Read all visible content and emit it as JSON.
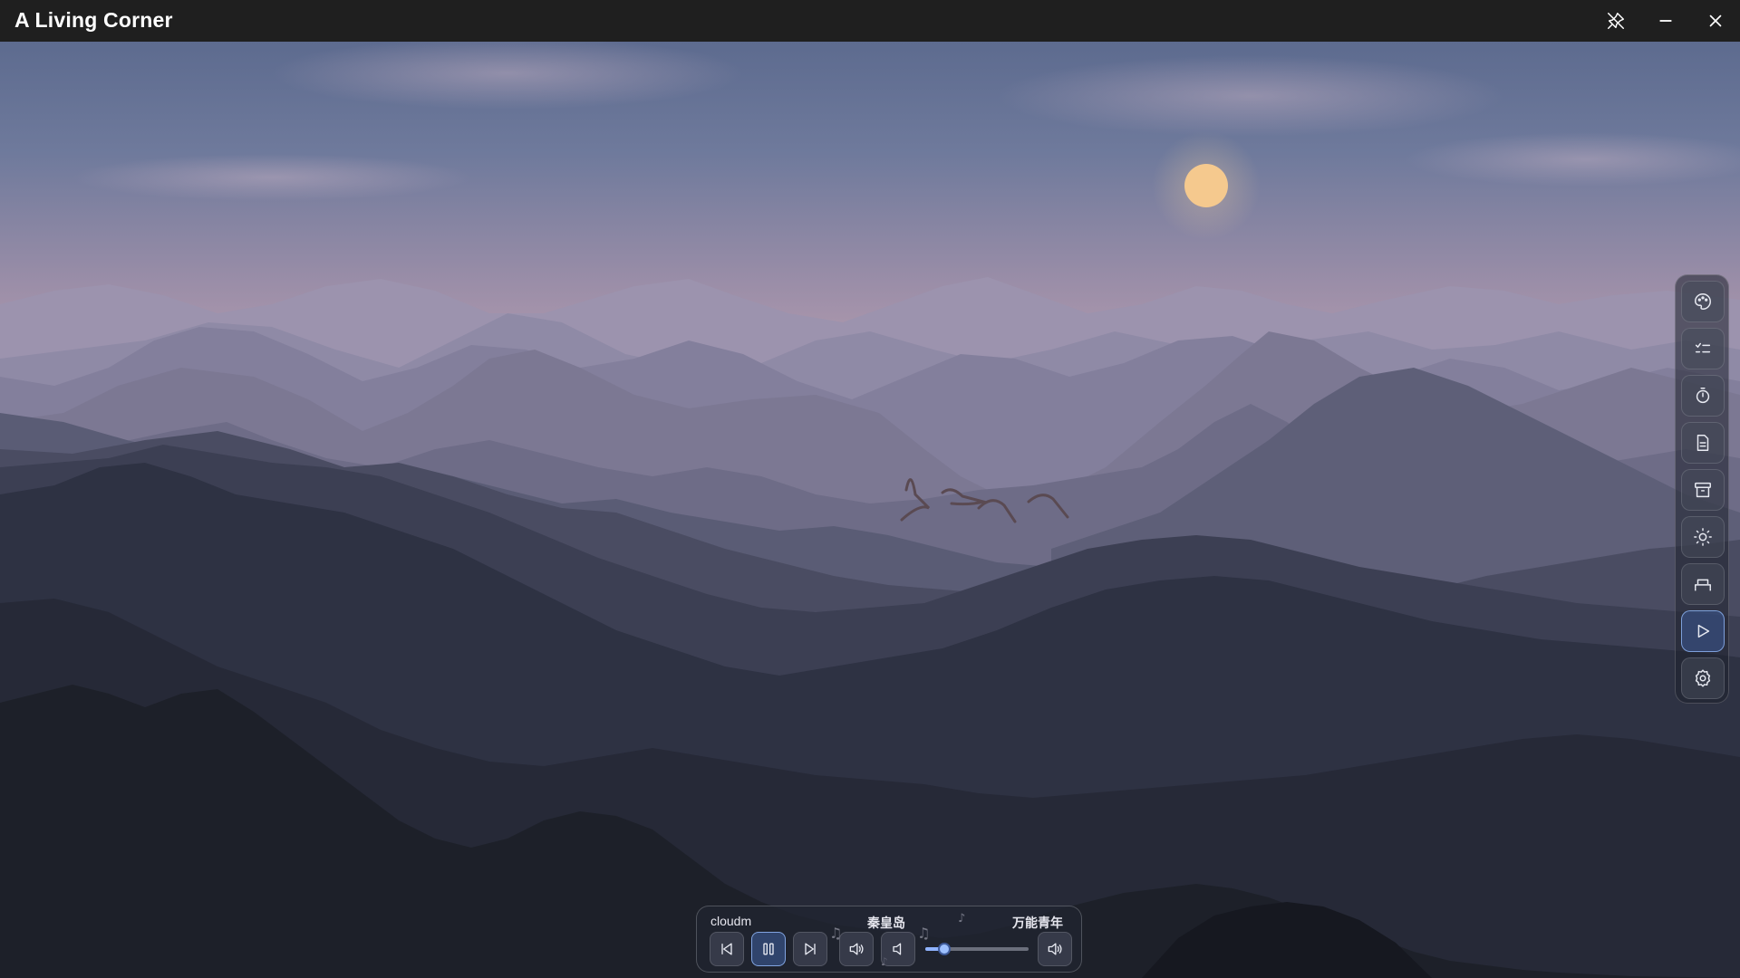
{
  "window": {
    "title": "A Living Corner",
    "controls": [
      {
        "name": "unpin-icon",
        "label": "Unpin"
      },
      {
        "name": "minimize-icon",
        "label": "Minimize"
      },
      {
        "name": "close-icon",
        "label": "Close"
      }
    ]
  },
  "scene": {
    "description_icons": [
      "sun",
      "birds",
      "mountains"
    ],
    "colors": {
      "sky_top": "#5f6e92",
      "sky_pink": "#b29cae",
      "sun": "#f5c98e",
      "mountain_far": "#8e8aa6",
      "mountain_dark": "#1f232c"
    }
  },
  "rail": {
    "items": [
      {
        "name": "theme-palette-icon",
        "active": false
      },
      {
        "name": "todo-list-icon",
        "active": false
      },
      {
        "name": "timer-icon",
        "active": false
      },
      {
        "name": "notes-icon",
        "active": false
      },
      {
        "name": "archive-icon",
        "active": false
      },
      {
        "name": "brightness-icon",
        "active": false
      },
      {
        "name": "bed-icon",
        "active": false
      },
      {
        "name": "play-icon",
        "active": true
      },
      {
        "name": "settings-icon",
        "active": false
      }
    ]
  },
  "player": {
    "artist": "cloudm",
    "track": "秦皇岛",
    "next_track": "万能青年",
    "volume_fraction": 0.18,
    "buttons": [
      "previous-icon",
      "pause-icon",
      "next-icon",
      "volume-icon",
      "volume-down-icon",
      "volume-up-icon"
    ]
  }
}
